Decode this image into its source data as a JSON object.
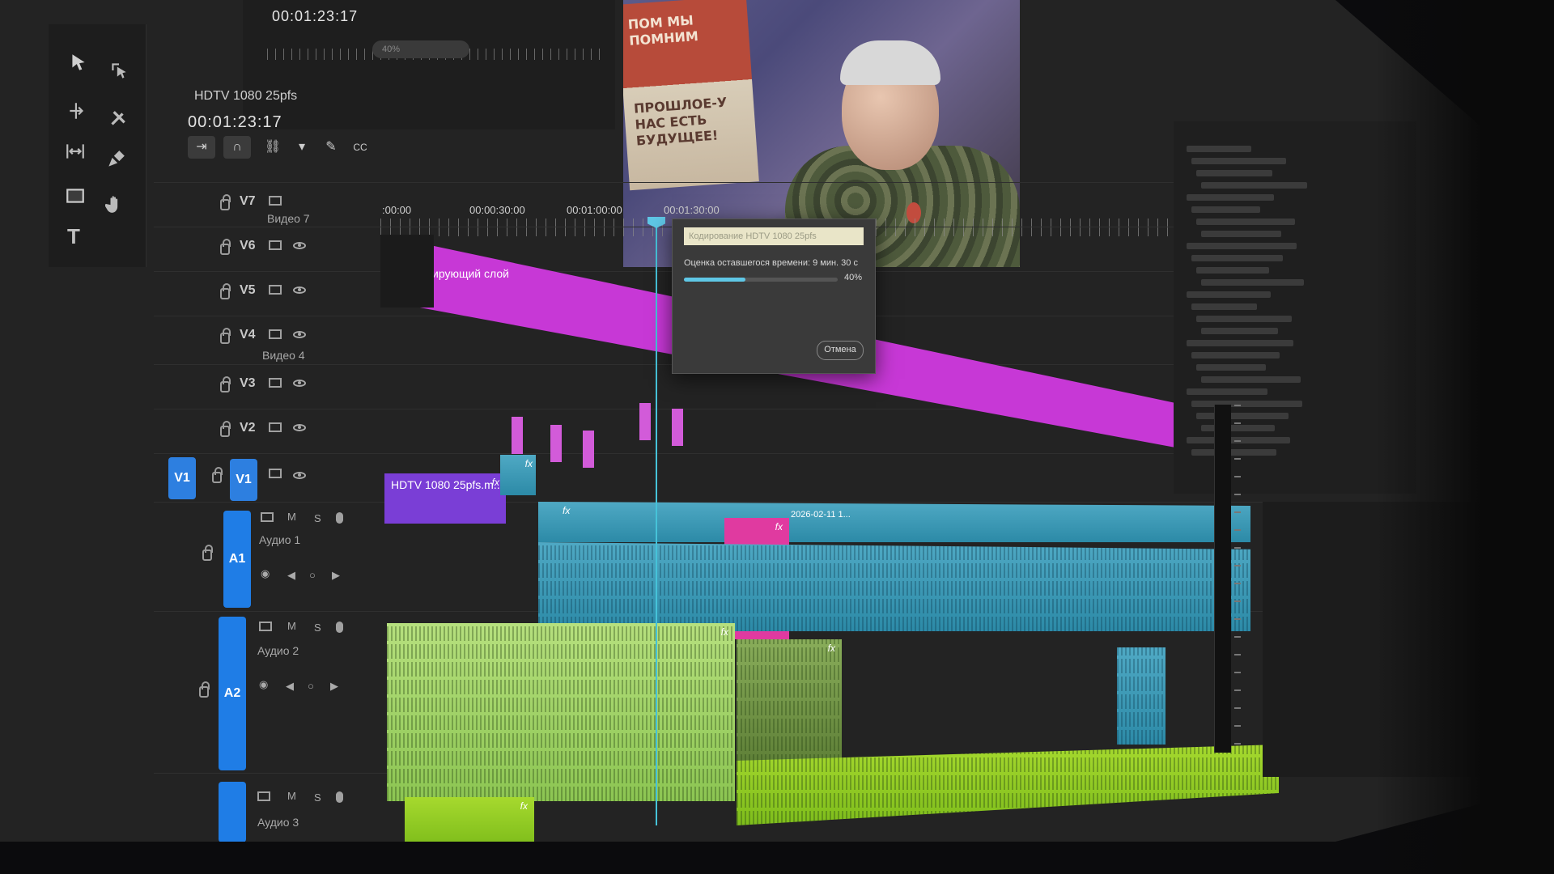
{
  "program_monitor": {
    "timecode": "00:01:23:17",
    "zoom": "40%",
    "poster_lines_top": "ПОМ МЫ ПОМНИМ",
    "poster_lines_bottom": "ПРОШЛОЕ-У НАС ЕСТЬ БУДУЩЕЕ!"
  },
  "timeline": {
    "sequence_name": "HDTV 1080 25pfs",
    "timecode": "00:01:23:17",
    "ruler": [
      ":00:00",
      "00:00:30:00",
      "00:01:00:00",
      "00:01:30:00"
    ],
    "tracks_video": [
      {
        "id": "V7",
        "name": "Видео 7"
      },
      {
        "id": "V6",
        "name": ""
      },
      {
        "id": "V5",
        "name": ""
      },
      {
        "id": "V4",
        "name": "Видео 4"
      },
      {
        "id": "V3",
        "name": ""
      },
      {
        "id": "V2",
        "name": ""
      },
      {
        "id": "V1",
        "name": ""
      }
    ],
    "tracks_audio": [
      {
        "id": "A1",
        "name": "Аудио 1"
      },
      {
        "id": "A2",
        "name": "Аудио 2"
      },
      {
        "id": "A3",
        "name": "Аудио 3"
      }
    ],
    "track_controls": {
      "mute": "M",
      "solo": "S"
    },
    "adjustment_clip_label": "Корректирующий слой",
    "v1_clip_label": "HDTV 1080 25pfs.m...",
    "dated_clip_label": "2026-02-11 1...",
    "fx_label": "fx"
  },
  "export_dialog": {
    "title": "Кодирование HDTV 1080 25pfs",
    "message": "Оценка оставшегося времени: 9 мин. 30 с",
    "progress": 0.4,
    "percent_label": "40%",
    "cancel_label": "Отмена"
  },
  "colors": {
    "adjustment": "#c738d6",
    "video_blue": "#4fa9c4",
    "audio_green": "#b6e07e",
    "target_blue": "#2d7fe0"
  }
}
